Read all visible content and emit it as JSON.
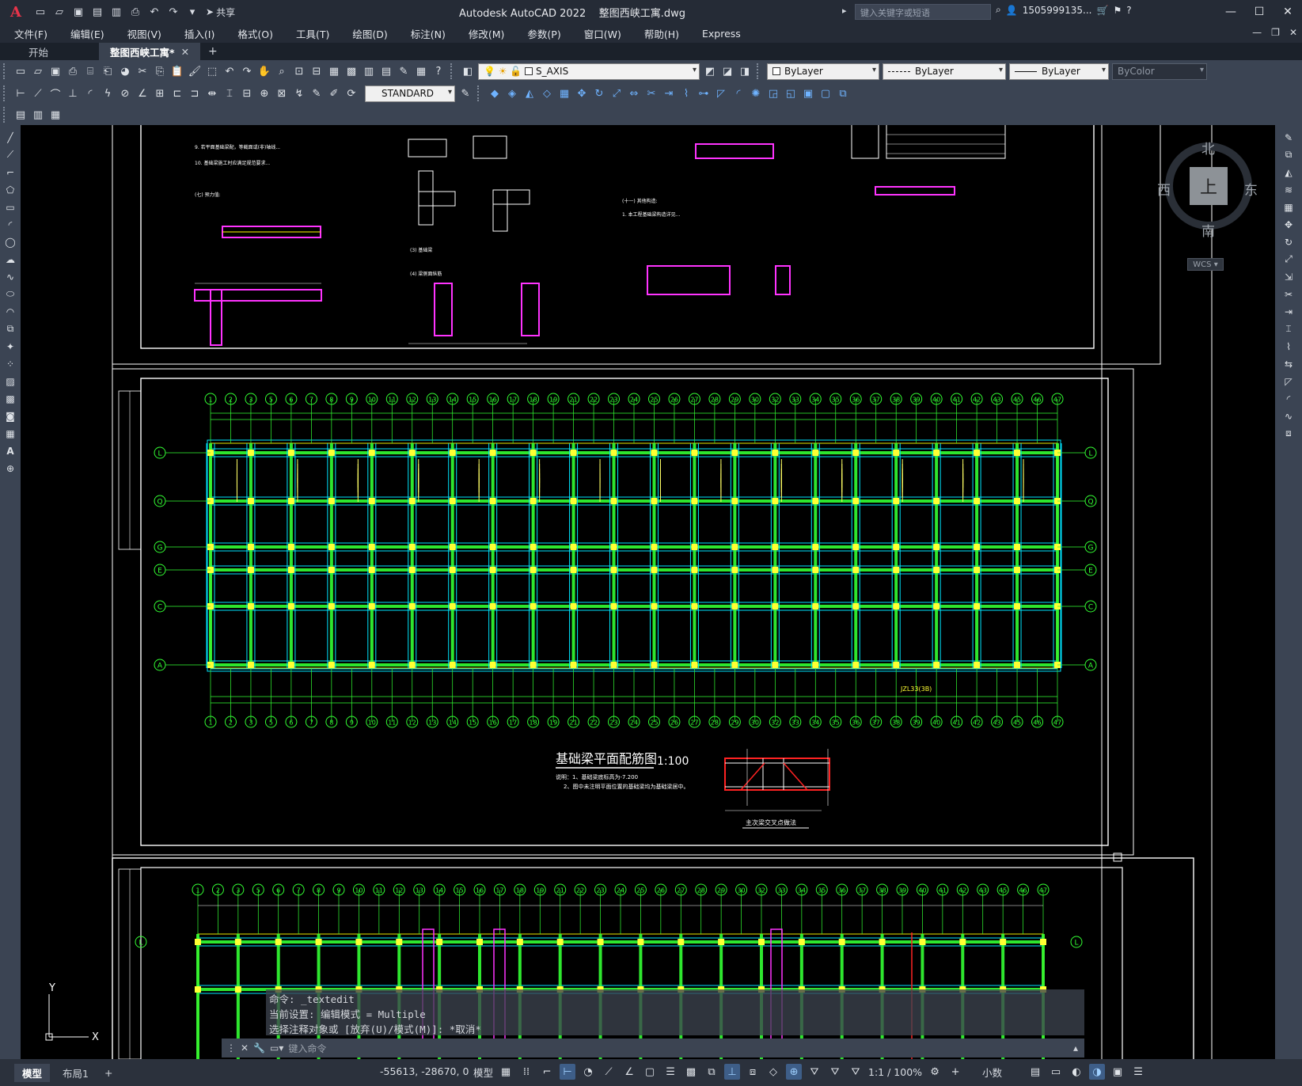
{
  "app": {
    "logo": "A",
    "title": "Autodesk AutoCAD 2022",
    "filename": "整图西峡工寓.dwg",
    "share_label": "共享",
    "search_placeholder": "键入关键字或短语",
    "user": "1505999135...",
    "help": "?"
  },
  "menu": [
    "文件(F)",
    "编辑(E)",
    "视图(V)",
    "插入(I)",
    "格式(O)",
    "工具(T)",
    "绘图(D)",
    "标注(N)",
    "修改(M)",
    "参数(P)",
    "窗口(W)",
    "帮助(H)",
    "Express"
  ],
  "tabs": [
    {
      "label": "开始",
      "active": false
    },
    {
      "label": "整图西峡工寓*",
      "active": true
    }
  ],
  "toolbars": {
    "layer_name": "S_AXIS",
    "color": "ByLayer",
    "linetype": "ByLayer",
    "lineweight": "ByLayer",
    "plotstyle": "ByColor",
    "textstyle": "STANDARD"
  },
  "viewcube": {
    "north": "北",
    "south": "南",
    "east": "东",
    "west": "西",
    "face": "上",
    "wcs": "WCS"
  },
  "drawing": {
    "plan_title": "基础梁平面配筋图",
    "plan_scale": "1:100",
    "note1": "说明：1、基础梁底标高为-7.200",
    "note2": "2、图中未注明平面位置的基础梁均为基础梁居中。",
    "detail_caption": "主次梁交叉点做法",
    "axis_rows": [
      "L",
      "Q",
      "G",
      "E",
      "C",
      "A"
    ],
    "axis_cols_top": [
      "1",
      "2",
      "3",
      "5",
      "6",
      "7",
      "8",
      "9",
      "10",
      "11",
      "12",
      "13",
      "14",
      "15",
      "16",
      "17",
      "18",
      "19",
      "21",
      "22",
      "23",
      "24",
      "25",
      "26",
      "27",
      "28",
      "29",
      "30",
      "32",
      "33",
      "34",
      "35",
      "36",
      "37",
      "38",
      "39",
      "40",
      "41",
      "42",
      "43",
      "45",
      "46",
      "47"
    ],
    "beam_label": "JZL33(3B)",
    "axis_y": "Y",
    "axis_x": "X"
  },
  "command": {
    "history": [
      "命令: _textedit",
      "当前设置: 编辑模式 = Multiple",
      "选择注释对象或 [放弃(U)/模式(M)]: *取消*"
    ],
    "placeholder": "键入命令"
  },
  "status": {
    "tabs": [
      "模型",
      "布局1"
    ],
    "coords": "-55613, -28670, 0",
    "mode": "模型",
    "scale": "1:1 / 100%",
    "units": "小数"
  }
}
